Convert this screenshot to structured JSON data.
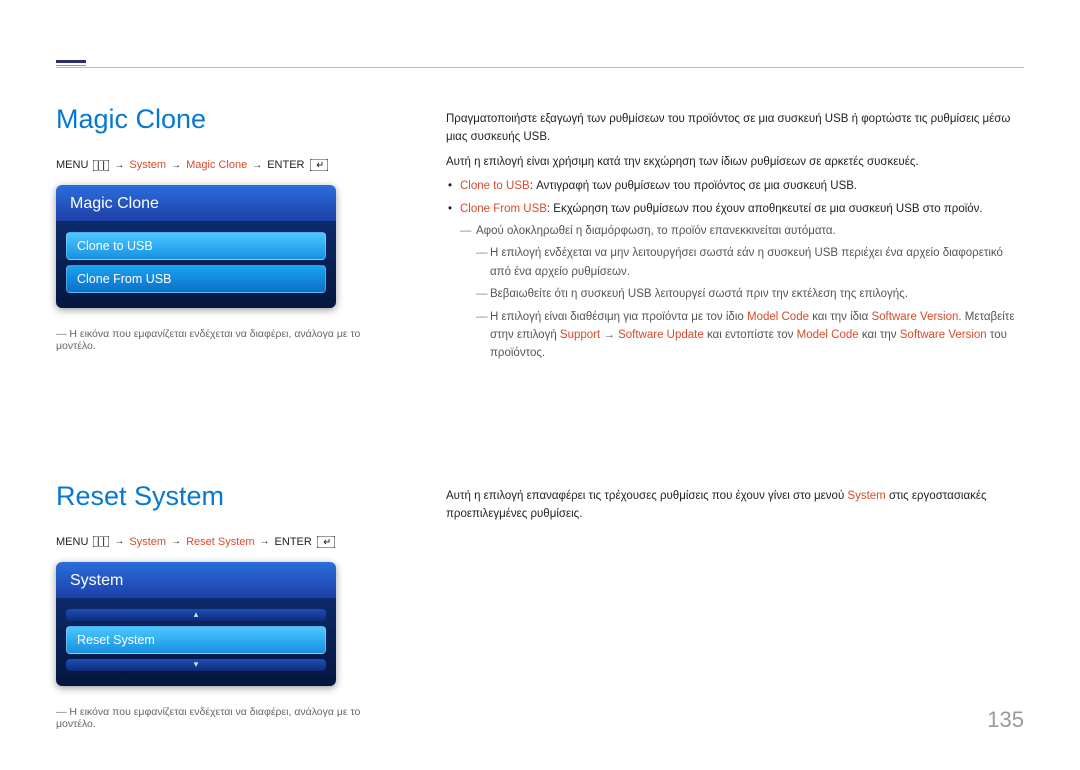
{
  "page_number": "135",
  "section1": {
    "heading": "Magic Clone",
    "breadcrumb": {
      "menu": "MENU",
      "system": "System",
      "item": "Magic Clone",
      "enter": "ENTER"
    },
    "card": {
      "title": "Magic Clone",
      "item_selected": "Clone to USB",
      "item2": "Clone From USB"
    },
    "note": "Η εικόνα που εμφανίζεται ενδέχεται να διαφέρει, ανάλογα με το μοντέλο.",
    "right": {
      "p1": "Πραγματοποιήστε εξαγωγή των ρυθμίσεων του προϊόντος σε μια συσκευή USB ή φορτώστε τις ρυθμίσεις μέσω μιας συσκευής USB.",
      "p2": "Αυτή η επιλογή είναι χρήσιμη κατά την εκχώρηση των ίδιων ρυθμίσεων σε αρκετές συσκευές.",
      "b1_label": "Clone to USB",
      "b1_rest": ": Αντιγραφή των ρυθμίσεων του προϊόντος σε μια συσκευή USB.",
      "b2_label": "Clone From USB",
      "b2_rest": ": Εκχώρηση των ρυθμίσεων που έχουν αποθηκευτεί σε μια συσκευή USB στο προϊόν.",
      "d1": "Αφού ολοκληρωθεί η διαμόρφωση, το προϊόν επανεκκινείται αυτόματα.",
      "d2": "Η επιλογή ενδέχεται να μην λειτουργήσει σωστά εάν η συσκευή USB περιέχει ένα αρχείο διαφορετικό από ένα αρχείο ρυθμίσεων.",
      "d3": "Βεβαιωθείτε ότι η συσκευή USB λειτουργεί σωστά πριν την εκτέλεση της επιλογής.",
      "d4_a": "Η επιλογή είναι διαθέσιμη για προϊόντα με τον ίδιο ",
      "d4_mc": "Model Code",
      "d4_b": " και την ίδια ",
      "d4_sv": "Software Version",
      "d4_c": ". Μεταβείτε στην επιλογή ",
      "d4_sup": "Support",
      "d4_arrow": " → ",
      "d4_su": "Software Update",
      "d4_d": " και εντοπίστε τον ",
      "d4_mc2": "Model Code",
      "d4_e": " και την ",
      "d4_sv2": "Software Version",
      "d4_f": " του προϊόντος."
    }
  },
  "section2": {
    "heading": "Reset System",
    "breadcrumb": {
      "menu": "MENU",
      "system": "System",
      "item": "Reset System",
      "enter": "ENTER"
    },
    "card": {
      "title": "System",
      "item_selected": "Reset System"
    },
    "note": "Η εικόνα που εμφανίζεται ενδέχεται να διαφέρει, ανάλογα με το μοντέλο.",
    "right": {
      "p1_a": "Αυτή η επιλογή επαναφέρει τις τρέχουσες ρυθμίσεις που έχουν γίνει στο μενού ",
      "p1_sys": "System",
      "p1_b": " στις εργοστασιακές προεπιλεγμένες ρυθμίσεις."
    }
  }
}
